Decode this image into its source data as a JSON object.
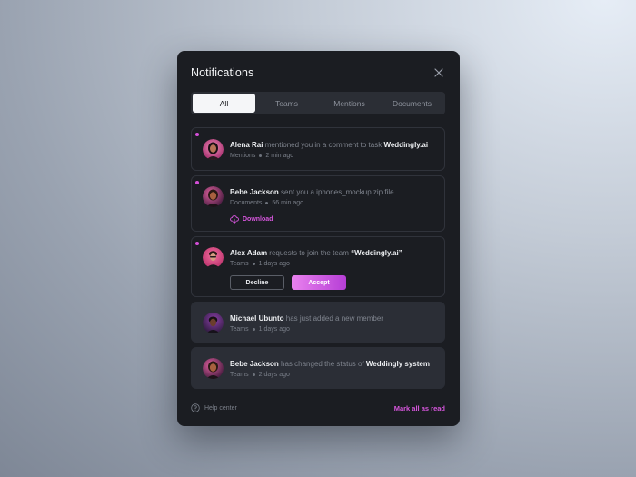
{
  "panel": {
    "title": "Notifications",
    "close_icon": "close-icon"
  },
  "tabs": [
    {
      "label": "All",
      "active": true
    },
    {
      "label": "Teams",
      "active": false
    },
    {
      "label": "Mentions",
      "active": false
    },
    {
      "label": "Documents",
      "active": false
    }
  ],
  "notifications": [
    {
      "unread": true,
      "name": "Alena Rai",
      "text": " mentioned you in a comment to task ",
      "target": "Weddingly.ai",
      "category": "Mentions",
      "time": "2 min ago"
    },
    {
      "unread": true,
      "name": "Bebe Jackson",
      "text": " sent you a iphones_mockup.zip file",
      "category": "Documents",
      "time": "56 min ago",
      "action_label": "Download",
      "action_icon": "cloud-download-icon"
    },
    {
      "unread": true,
      "name": "Alex Adam",
      "text": " requests to join the team ",
      "target": "“Weddingly.ai”",
      "category": "Teams",
      "time": "1 days ago",
      "decline_label": "Decline",
      "accept_label": "Accept"
    },
    {
      "unread": false,
      "name": "Michael Ubunto",
      "text": " has just added a new member",
      "category": "Teams",
      "time": "1 days ago"
    },
    {
      "unread": false,
      "name": "Bebe Jackson",
      "text": " has changed the status of ",
      "target": "Weddingly system",
      "category": "Teams",
      "time": "2 days ago"
    }
  ],
  "footer": {
    "help_label": "Help center",
    "help_icon": "help-circle-icon",
    "mark_all_label": "Mark all as read"
  },
  "colors": {
    "accent": "#d756dd",
    "panel_bg": "#1b1d22",
    "unread_dot": "#d44fd8"
  }
}
